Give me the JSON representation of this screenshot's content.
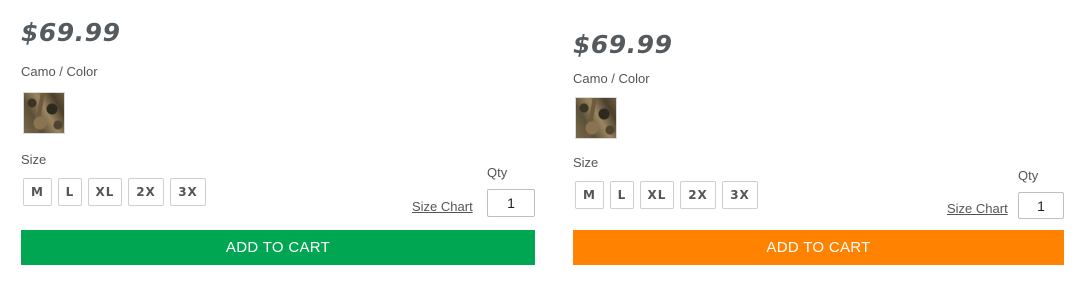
{
  "products": [
    {
      "price": "$69.99",
      "camo_label": "Camo / Color",
      "swatch_icon": "camo-swatch",
      "size_label": "Size",
      "sizes": [
        "M",
        "L",
        "XL",
        "2X",
        "3X"
      ],
      "size_chart_label": "Size Chart",
      "qty_label": "Qty",
      "qty_value": "1",
      "add_to_cart_label": "ADD TO CART",
      "add_to_cart_color": "#00a651"
    },
    {
      "price": "$69.99",
      "camo_label": "Camo / Color",
      "swatch_icon": "camo-swatch",
      "size_label": "Size",
      "sizes": [
        "M",
        "L",
        "XL",
        "2X",
        "3X"
      ],
      "size_chart_label": "Size Chart",
      "qty_label": "Qty",
      "qty_value": "1",
      "add_to_cart_label": "ADD TO CART",
      "add_to_cart_color": "#ff8200"
    }
  ]
}
